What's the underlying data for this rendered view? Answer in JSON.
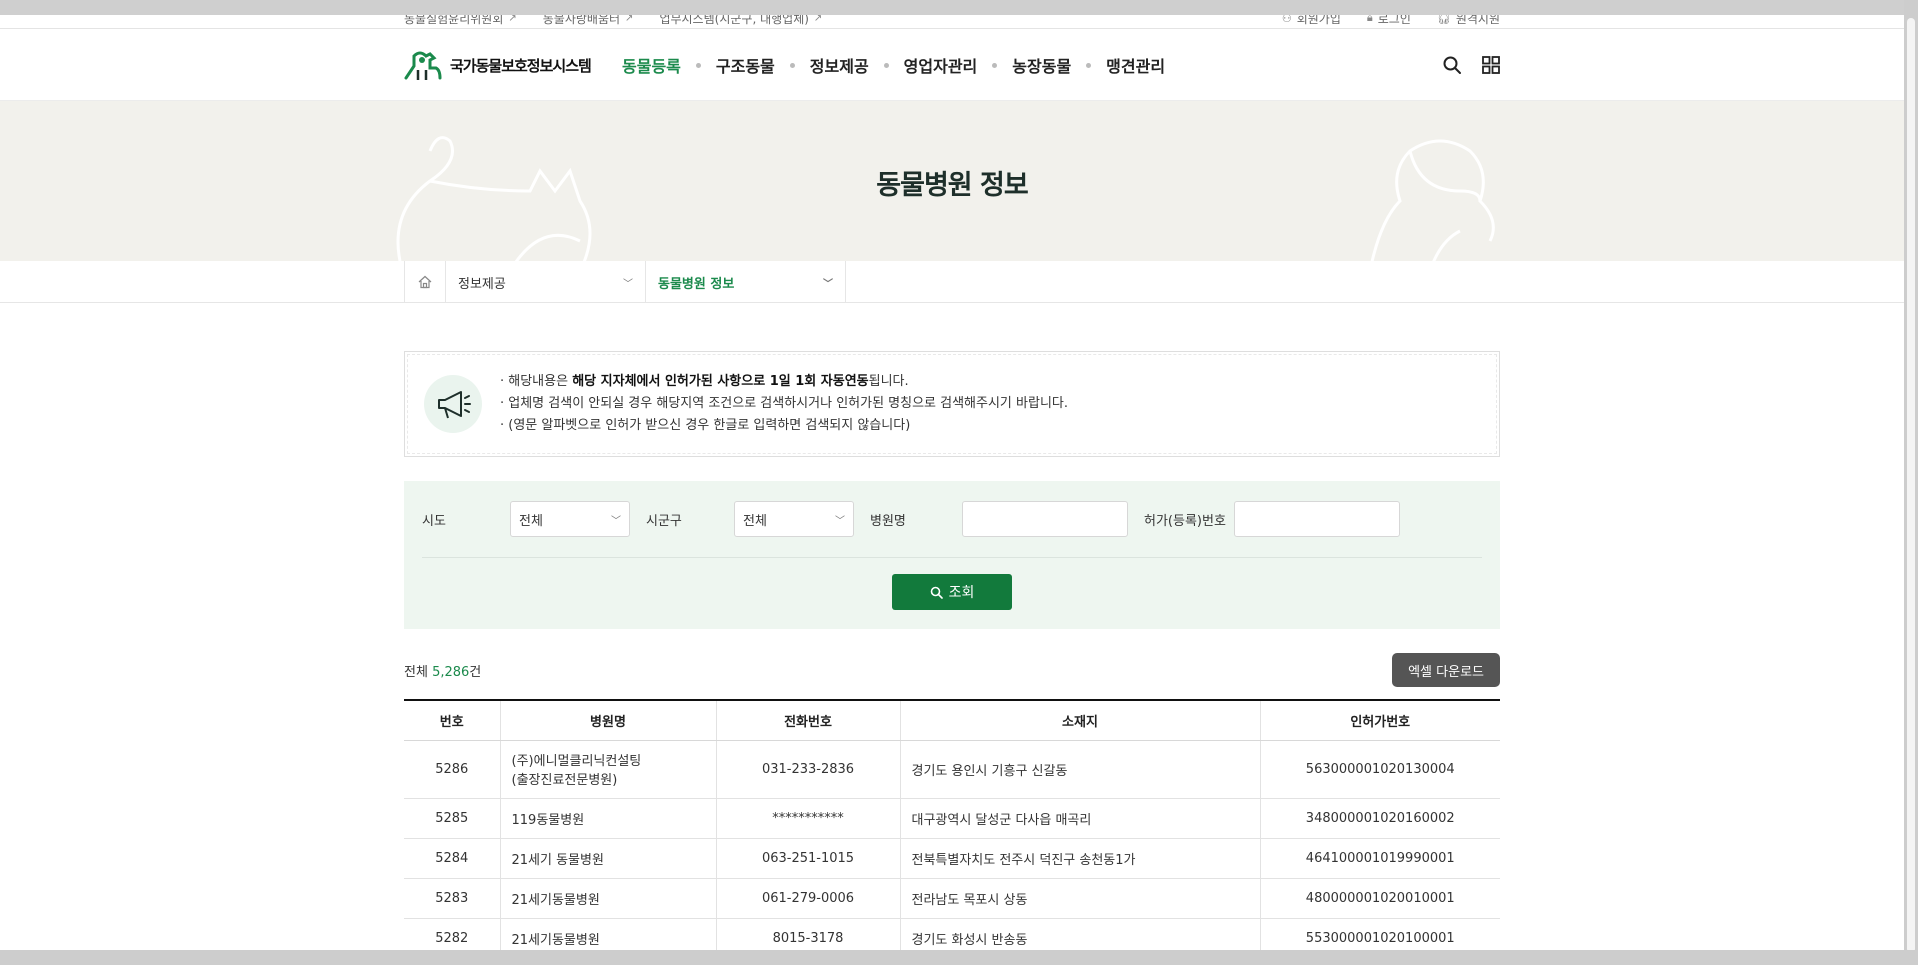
{
  "util": {
    "left": [
      {
        "label": "동물실험윤리위원회"
      },
      {
        "label": "동물사랑배움터"
      },
      {
        "label": "업무시스템(시군구, 대행업체)"
      }
    ],
    "right": [
      {
        "label": "회원가입"
      },
      {
        "label": "로그인"
      },
      {
        "label": "원격지원"
      }
    ]
  },
  "header": {
    "logo_text": "국가동물보호정보시스템",
    "nav": [
      "동물등록",
      "구조동물",
      "정보제공",
      "영업자관리",
      "농장동물",
      "맹견관리"
    ],
    "active_index": 0,
    "accent": "#1b8a4c"
  },
  "hero": {
    "title": "동물병원 정보"
  },
  "breadcrumb": {
    "level1": "정보제공",
    "level2": "동물병원 정보"
  },
  "notice": {
    "line1_pre": "해당내용은 ",
    "line1_bold": "해당 지자체에서 인허가된 사항으로 1일 1회 자동연동",
    "line1_post": "됩니다.",
    "line2": "업체명 검색이 안되실 경우 해당지역 조건으로 검색하시거나 인허가된 명칭으로 검색해주시기 바랍니다.",
    "line3": "(영문 알파벳으로 인허가 받으신 경우 한글로 입력하면 검색되지 않습니다)"
  },
  "search": {
    "sido_label": "시도",
    "sido_value": "전체",
    "sigungu_label": "시군구",
    "sigungu_value": "전체",
    "hospital_label": "병원명",
    "hospital_value": "",
    "license_label": "허가(등록)번호",
    "license_value": "",
    "button": "조회"
  },
  "result": {
    "total_pre": "전체 ",
    "total_num": "5,286",
    "total_post": "건",
    "excel_button": "엑셀 다운로드"
  },
  "table": {
    "headers": [
      "번호",
      "병원명",
      "전화번호",
      "소재지",
      "인허가번호"
    ],
    "rows": [
      {
        "no": "5286",
        "name1": "(주)에니멀클리닉컨설팅",
        "name2": "(출장진료전문병원)",
        "phone": "031-233-2836",
        "addr": "경기도 용인시 기흥구 신갈동",
        "license": "563000001020130004"
      },
      {
        "no": "5285",
        "name1": "119동물병원",
        "name2": "",
        "phone": "***********",
        "addr": "대구광역시 달성군 다사읍 매곡리",
        "license": "348000001020160002"
      },
      {
        "no": "5284",
        "name1": "21세기 동물병원",
        "name2": "",
        "phone": "063-251-1015",
        "addr": "전북특별자치도 전주시 덕진구 송천동1가",
        "license": "464100001019990001"
      },
      {
        "no": "5283",
        "name1": "21세기동물병원",
        "name2": "",
        "phone": "061-279-0006",
        "addr": "전라남도 목포시 상동",
        "license": "480000001020010001"
      },
      {
        "no": "5282",
        "name1": "21세기동물병원",
        "name2": "",
        "phone": "8015-3178",
        "addr": "경기도 화성시 반송동",
        "license": "553000001020100001"
      }
    ]
  }
}
